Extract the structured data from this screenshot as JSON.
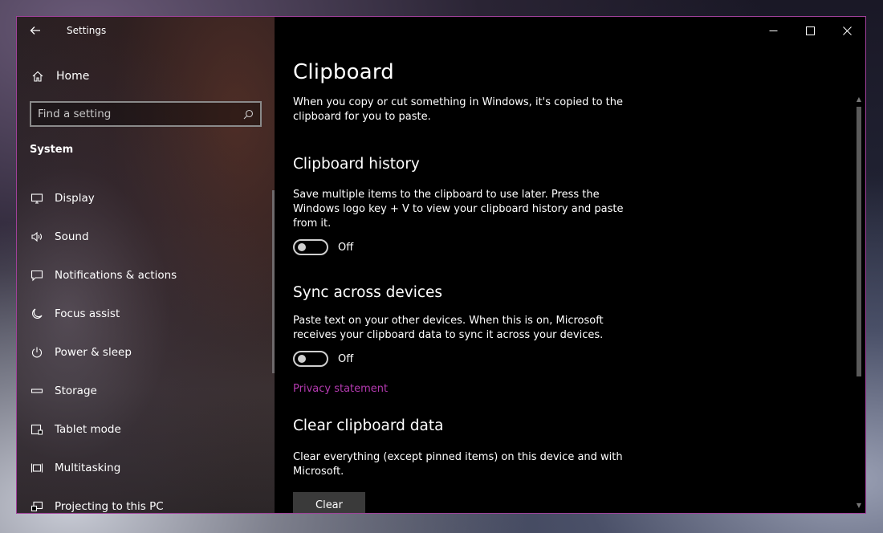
{
  "window": {
    "title": "Settings",
    "accent_color": "#b43ab0"
  },
  "sidebar": {
    "home_label": "Home",
    "search_placeholder": "Find a setting",
    "section_label": "System",
    "items": [
      {
        "label": "Display",
        "icon": "monitor-icon"
      },
      {
        "label": "Sound",
        "icon": "speaker-icon"
      },
      {
        "label": "Notifications & actions",
        "icon": "notification-icon"
      },
      {
        "label": "Focus assist",
        "icon": "moon-icon"
      },
      {
        "label": "Power & sleep",
        "icon": "power-icon"
      },
      {
        "label": "Storage",
        "icon": "storage-icon"
      },
      {
        "label": "Tablet mode",
        "icon": "tablet-icon"
      },
      {
        "label": "Multitasking",
        "icon": "multitasking-icon"
      },
      {
        "label": "Projecting to this PC",
        "icon": "projecting-icon"
      }
    ]
  },
  "main": {
    "page_title": "Clipboard",
    "intro": "When you copy or cut something in Windows, it's copied to the clipboard for you to paste.",
    "history": {
      "heading": "Clipboard history",
      "desc": "Save multiple items to the clipboard to use later. Press the Windows logo key + V to view your clipboard history and paste from it.",
      "toggle_label": "Off"
    },
    "sync": {
      "heading": "Sync across devices",
      "desc": "Paste text on your other devices. When this is on, Microsoft receives your clipboard data to sync it across your devices.",
      "toggle_label": "Off",
      "privacy_link": "Privacy statement"
    },
    "clear": {
      "heading": "Clear clipboard data",
      "desc": "Clear everything (except pinned items) on this device and with Microsoft.",
      "button_label": "Clear"
    }
  }
}
